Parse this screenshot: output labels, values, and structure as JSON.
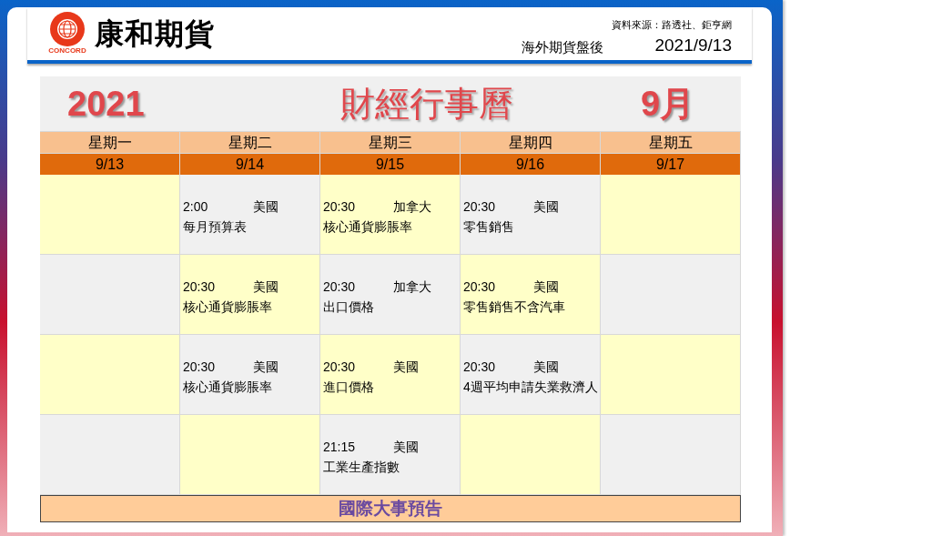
{
  "header": {
    "logo_caption": "CONCORD",
    "brand": "康和期貨",
    "source": "資料來源：路透社、鉅亨網",
    "subtitle": "海外期貨盤後",
    "date": "2021/9/13"
  },
  "calendar": {
    "year": "2021",
    "title": "財經行事曆",
    "month": "9月",
    "days": [
      {
        "weekday": "星期一",
        "date": "9/13"
      },
      {
        "weekday": "星期二",
        "date": "9/14"
      },
      {
        "weekday": "星期三",
        "date": "9/15"
      },
      {
        "weekday": "星期四",
        "date": "9/16"
      },
      {
        "weekday": "星期五",
        "date": "9/17"
      }
    ],
    "rows": [
      [
        {
          "kind": "empty"
        },
        {
          "kind": "event",
          "time": "2:00",
          "country": "美國",
          "event": "每月預算表"
        },
        {
          "kind": "event",
          "time": "20:30",
          "country": "加拿大",
          "event": "核心通貨膨脹率"
        },
        {
          "kind": "event",
          "time": "20:30",
          "country": "美國",
          "event": "零售銷售"
        },
        {
          "kind": "empty"
        }
      ],
      [
        {
          "kind": "empty"
        },
        {
          "kind": "event",
          "time": "20:30",
          "country": "美國",
          "event": "核心通貨膨脹率"
        },
        {
          "kind": "event",
          "time": "20:30",
          "country": "加拿大",
          "event": "出口價格"
        },
        {
          "kind": "event",
          "time": "20:30",
          "country": "美國",
          "event": "零售銷售不含汽車"
        },
        {
          "kind": "empty"
        }
      ],
      [
        {
          "kind": "empty"
        },
        {
          "kind": "event",
          "time": "20:30",
          "country": "美國",
          "event": "核心通貨膨脹率"
        },
        {
          "kind": "event",
          "time": "20:30",
          "country": "美國",
          "event": "進口價格"
        },
        {
          "kind": "event",
          "time": "20:30",
          "country": "美國",
          "event": "4週平均申請失業救濟人"
        },
        {
          "kind": "empty"
        }
      ],
      [
        {
          "kind": "empty"
        },
        {
          "kind": "empty"
        },
        {
          "kind": "event",
          "time": "21:15",
          "country": "美國",
          "event": "工業生產指數"
        },
        {
          "kind": "empty"
        },
        {
          "kind": "empty"
        }
      ]
    ],
    "footer": "國際大事預告"
  }
}
